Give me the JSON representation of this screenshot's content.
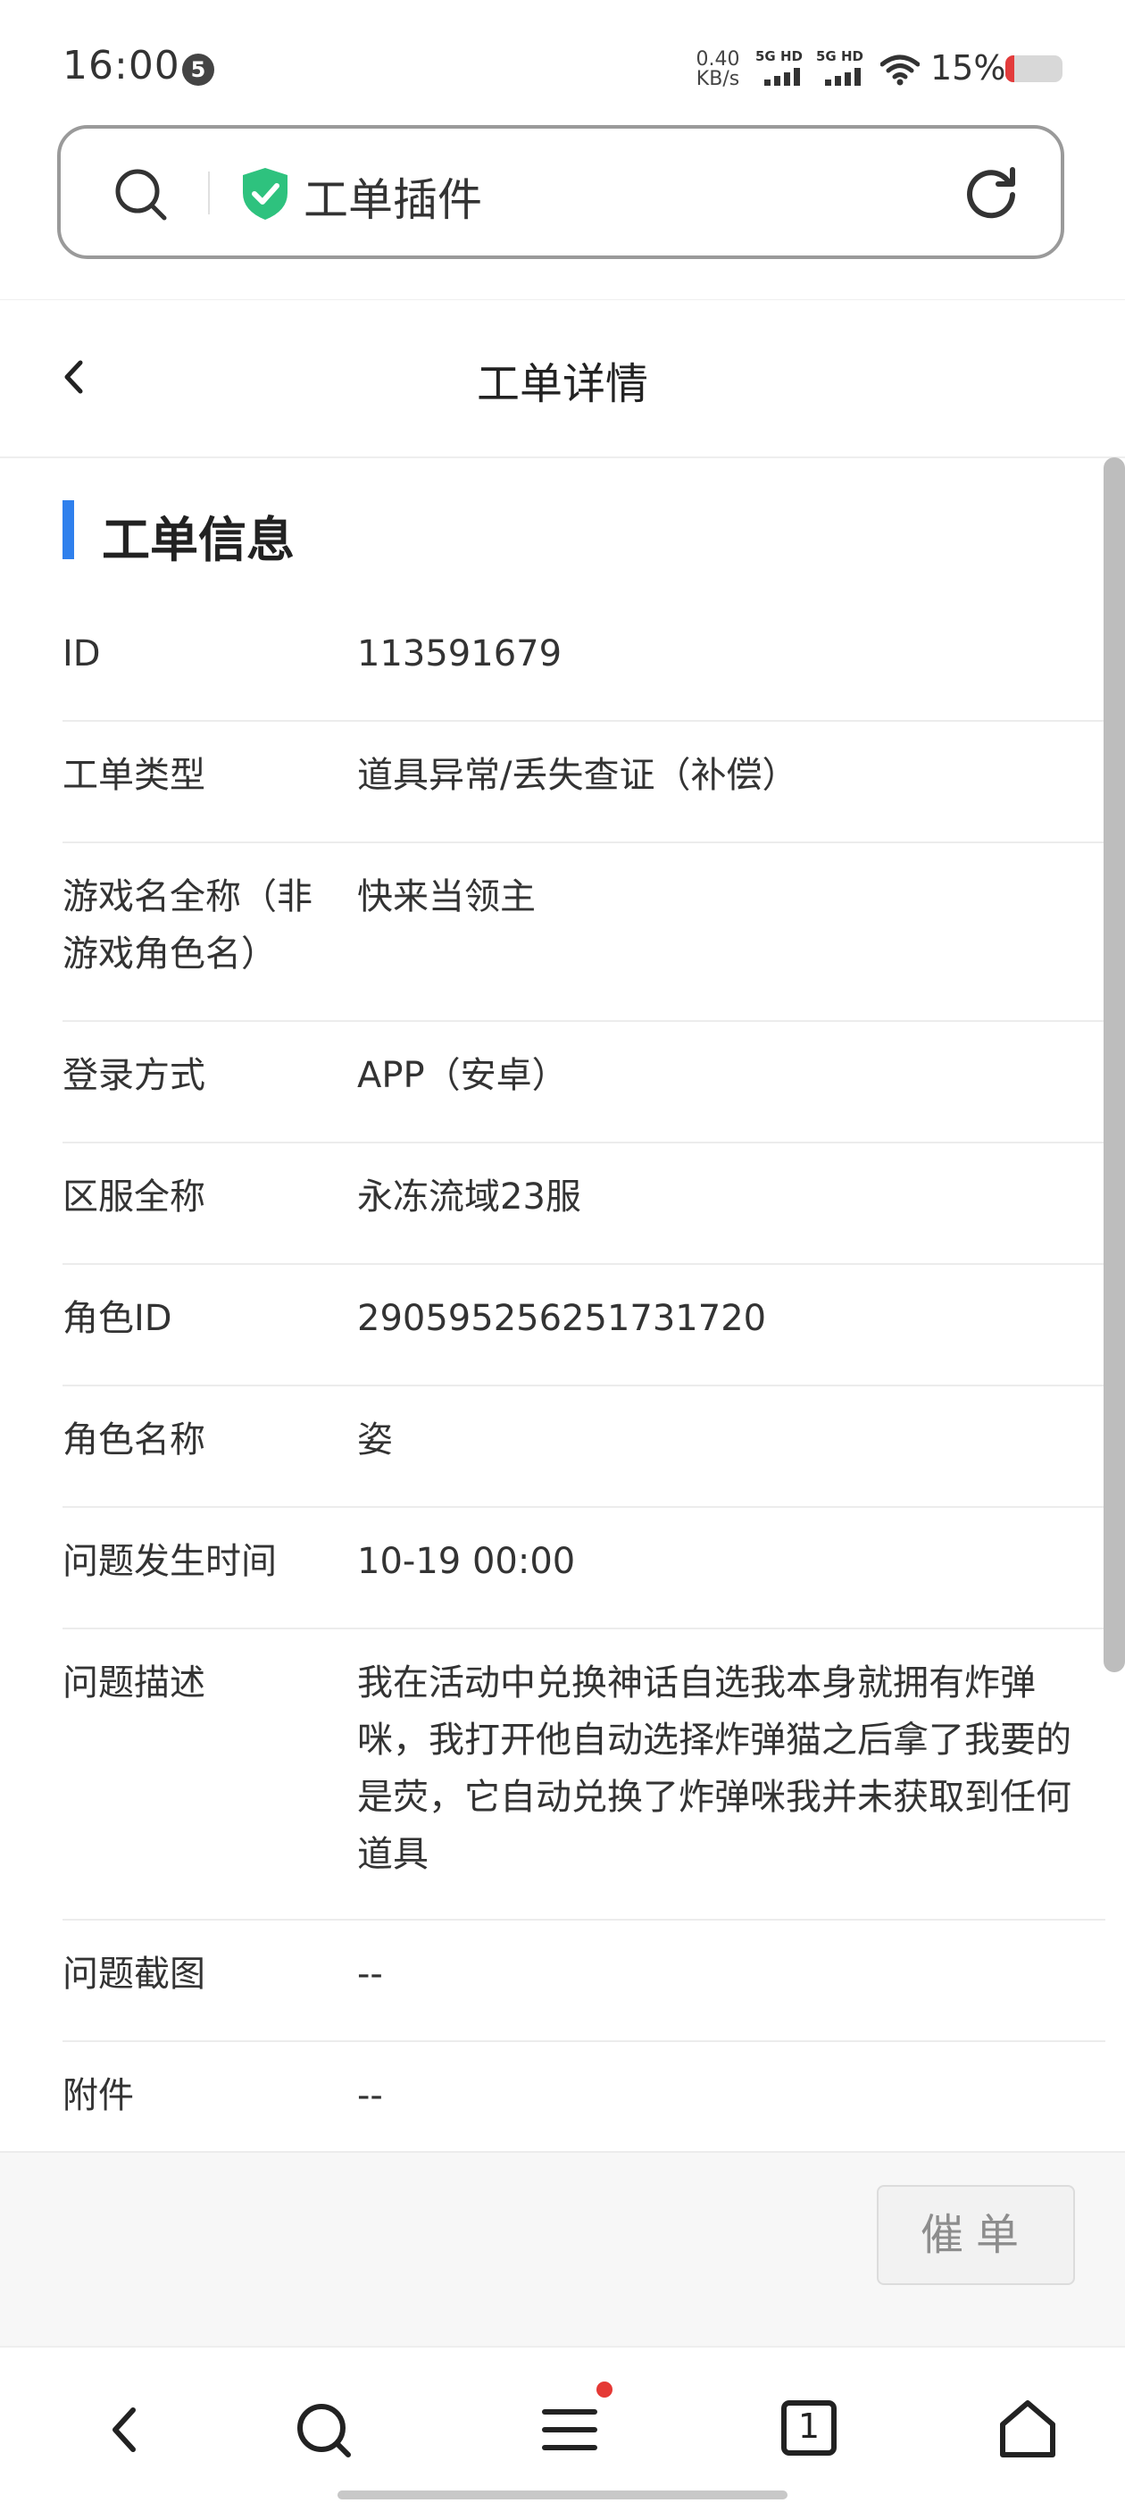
{
  "status_bar": {
    "time": "16:00",
    "notification_count": "5",
    "net_speed_value": "0.40",
    "net_speed_unit": "KB/s",
    "signal1_label": "5G HD",
    "signal2_label": "5G HD",
    "battery": "15%",
    "battery_level": 0.15,
    "battery_color": "#e33b3b"
  },
  "url_bar": {
    "title": "工单插件",
    "shield_color": "#2ec27e"
  },
  "header": {
    "title": "工单详情"
  },
  "section": {
    "title": "工单信息",
    "accent_color": "#2f80ed"
  },
  "rows": [
    {
      "label": "ID",
      "value": "113591679"
    },
    {
      "label": "工单类型",
      "value": "道具异常/丢失查证（补偿）"
    },
    {
      "label": "游戏名全称（非游戏角色名）",
      "value": "快来当领主"
    },
    {
      "label": "登录方式",
      "value": "APP（安卓）"
    },
    {
      "label": "区服全称",
      "value": "永冻流域23服"
    },
    {
      "label": "角色ID",
      "value": "290595256251731720"
    },
    {
      "label": "角色名称",
      "value": "姿"
    },
    {
      "label": "问题发生时间",
      "value": "10-19 00:00"
    },
    {
      "label": "问题描述",
      "value": "我在活动中兑换神话自选我本身就拥有炸弹咪，我打开他自动选择炸弹猫之后拿了我要的是荧，它自动兑换了炸弹咪我并未获取到任何道具"
    },
    {
      "label": "问题截图",
      "value": "--"
    },
    {
      "label": "附件",
      "value": "--"
    }
  ],
  "actions": {
    "urge_label": "催单"
  },
  "bottom_nav": {
    "tab_count": "1",
    "menu_has_notification": true
  }
}
